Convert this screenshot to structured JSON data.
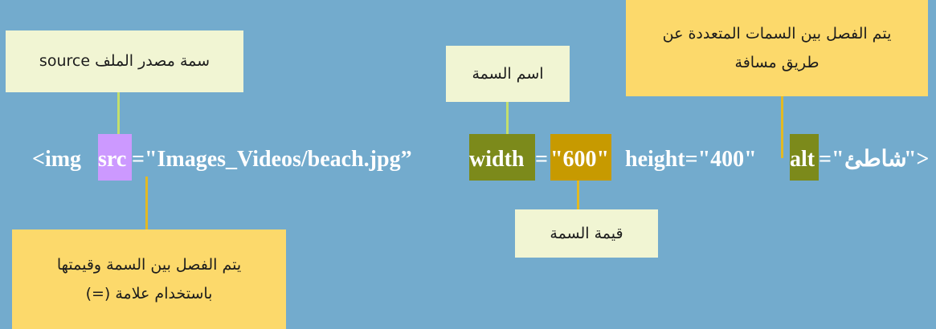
{
  "callouts": {
    "source_attr": "سمة مصدر الملف source",
    "attr_name": "اسم السمة",
    "multi_sep_line1": "يتم الفصل بين السمات المتعددة عن",
    "multi_sep_line2": "طريق مسافة",
    "name_value_sep_line1": "يتم الفصل بين السمة وقيمتها",
    "name_value_sep_line2": "باستخدام علامة (=)",
    "attr_value": "قيمة السمة"
  },
  "code": {
    "open": "<img",
    "src": "src",
    "src_value": "=\"Images_Videos/beach.jpg”",
    "width": "width",
    "eq1": "=",
    "width_value": "\"600\"",
    "height": "height=\"400\"",
    "alt": "alt",
    "alt_eq": "=\"",
    "alt_value": "شاطئ",
    "close": "\">"
  },
  "colors": {
    "background": "#73abcd",
    "cream_box": "#f1f5d3",
    "yellow_box": "#fcd96b",
    "src_highlight": "#cc99ff",
    "name_highlight": "#7c8a1b",
    "value_highlight": "#c79a00"
  }
}
